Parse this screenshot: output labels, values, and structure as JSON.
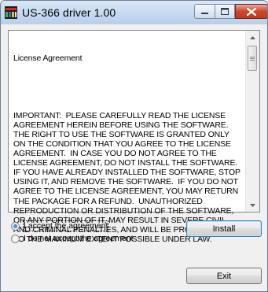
{
  "window": {
    "title": "US-366 driver 1.00",
    "controls": [
      "minimize",
      "maximize",
      "close"
    ]
  },
  "license": {
    "heading": "License Agreement",
    "body": "IMPORTANT:  PLEASE CAREFULLY READ THE LICENSE\nAGREEMENT HEREIN BEFORE USING THE SOFTWARE.\nTHE RIGHT TO USE THE SOFTWARE IS GRANTED ONLY\nON THE CONDITION THAT YOU AGREE TO THE LICENSE\nAGREEMENT.  IN CASE YOU DO NOT AGREE TO THE\nLICENSE AGREEMENT, DO NOT INSTALL THE SOFTWARE.\nIF YOU HAVE ALREADY INSTALLED THE SOFTWARE, STOP\nUSING IT, AND REMOVE THE SOFTWARE.  IF YOU DO NOT\nAGREE TO THE LICENSE AGREEMENT, YOU MAY RETURN\nTHE PACKAGE FOR A REFUND.  UNAUTHORIZED\nREPRODUCTION OR DISTRIBUTION OF THE SOFTWARE,\nOR ANY PORTION OF IT, MAY RESULT IN SEVERE CIVIL\nAND CRIMINAL PENALTIES, AND WILL BE PROSECUTED\nTO THE MAXIMUM EXTENT POSSIBLE UNDER LAW."
  },
  "options": {
    "accept_label": "I accept the agreement",
    "decline_label": "I do not accept the agreement",
    "selected": "accept"
  },
  "buttons": {
    "install_label": "Install",
    "exit_label": "Exit"
  },
  "colors": {
    "title_bar": "#c5d9f0",
    "close_button": "#c9462c",
    "window_bg": "#f0f0f0"
  }
}
